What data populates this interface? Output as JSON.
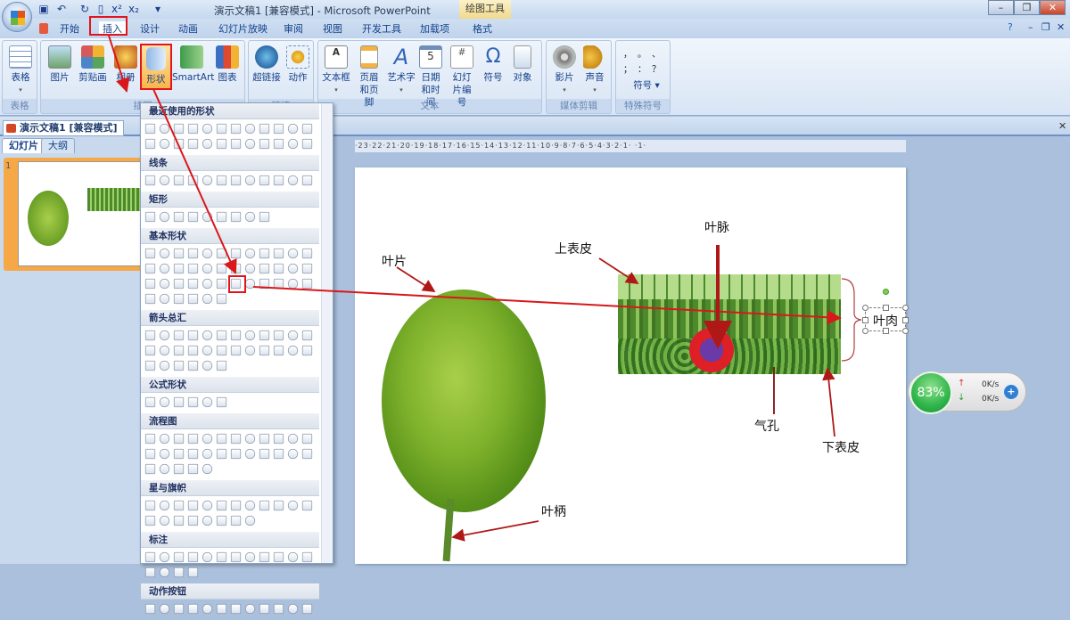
{
  "window": {
    "title": "演示文稿1 [兼容模式] - Microsoft PowerPoint",
    "context_tab": "绘图工具"
  },
  "tabs": [
    "开始",
    "插入",
    "设计",
    "动画",
    "幻灯片放映",
    "审阅",
    "视图",
    "开发工具",
    "加载项",
    "格式"
  ],
  "ribbon": {
    "groups": [
      {
        "label": "表格",
        "buttons": [
          "表格"
        ]
      },
      {
        "label": "插图",
        "buttons": [
          "图片",
          "剪贴画",
          "相册",
          "形状",
          "SmartArt",
          "图表"
        ]
      },
      {
        "label": "链接",
        "buttons": [
          "超链接",
          "动作"
        ]
      },
      {
        "label": "文本",
        "buttons": [
          "文本框",
          "页眉和页脚",
          "艺术字",
          "日期和时间",
          "幻灯片编号",
          "符号",
          "对象"
        ]
      },
      {
        "label": "媒体剪辑",
        "buttons": [
          "影片",
          "声音"
        ]
      },
      {
        "label": "特殊符号",
        "buttons": [
          "符号"
        ],
        "symbols": [
          "，",
          "。",
          "、",
          "；",
          "：",
          "？"
        ]
      }
    ]
  },
  "document_tab": "演示文稿1 [兼容模式]",
  "pane_tabs": [
    "幻灯片",
    "大纲"
  ],
  "slide_number": "1",
  "ruler": "·23·22·21·20·19·18·17·16·15·14·13·12·11·10·9·8·7·6·5·4·3·2·1· ·1·",
  "shapes_panel": {
    "sections": [
      "最近使用的形状",
      "线条",
      "矩形",
      "基本形状",
      "箭头总汇",
      "公式形状",
      "流程图",
      "星与旗帜",
      "标注",
      "动作按钮"
    ]
  },
  "slide": {
    "labels": {
      "blade": "叶片",
      "petiole": "叶柄",
      "upper_epidermis": "上表皮",
      "vein": "叶脉",
      "stoma": "气孔",
      "lower_epidermis": "下表皮",
      "mesophyll": "叶肉"
    }
  },
  "net_widget": {
    "percent": "83%",
    "upload": "0K/s",
    "download": "0K/s"
  }
}
